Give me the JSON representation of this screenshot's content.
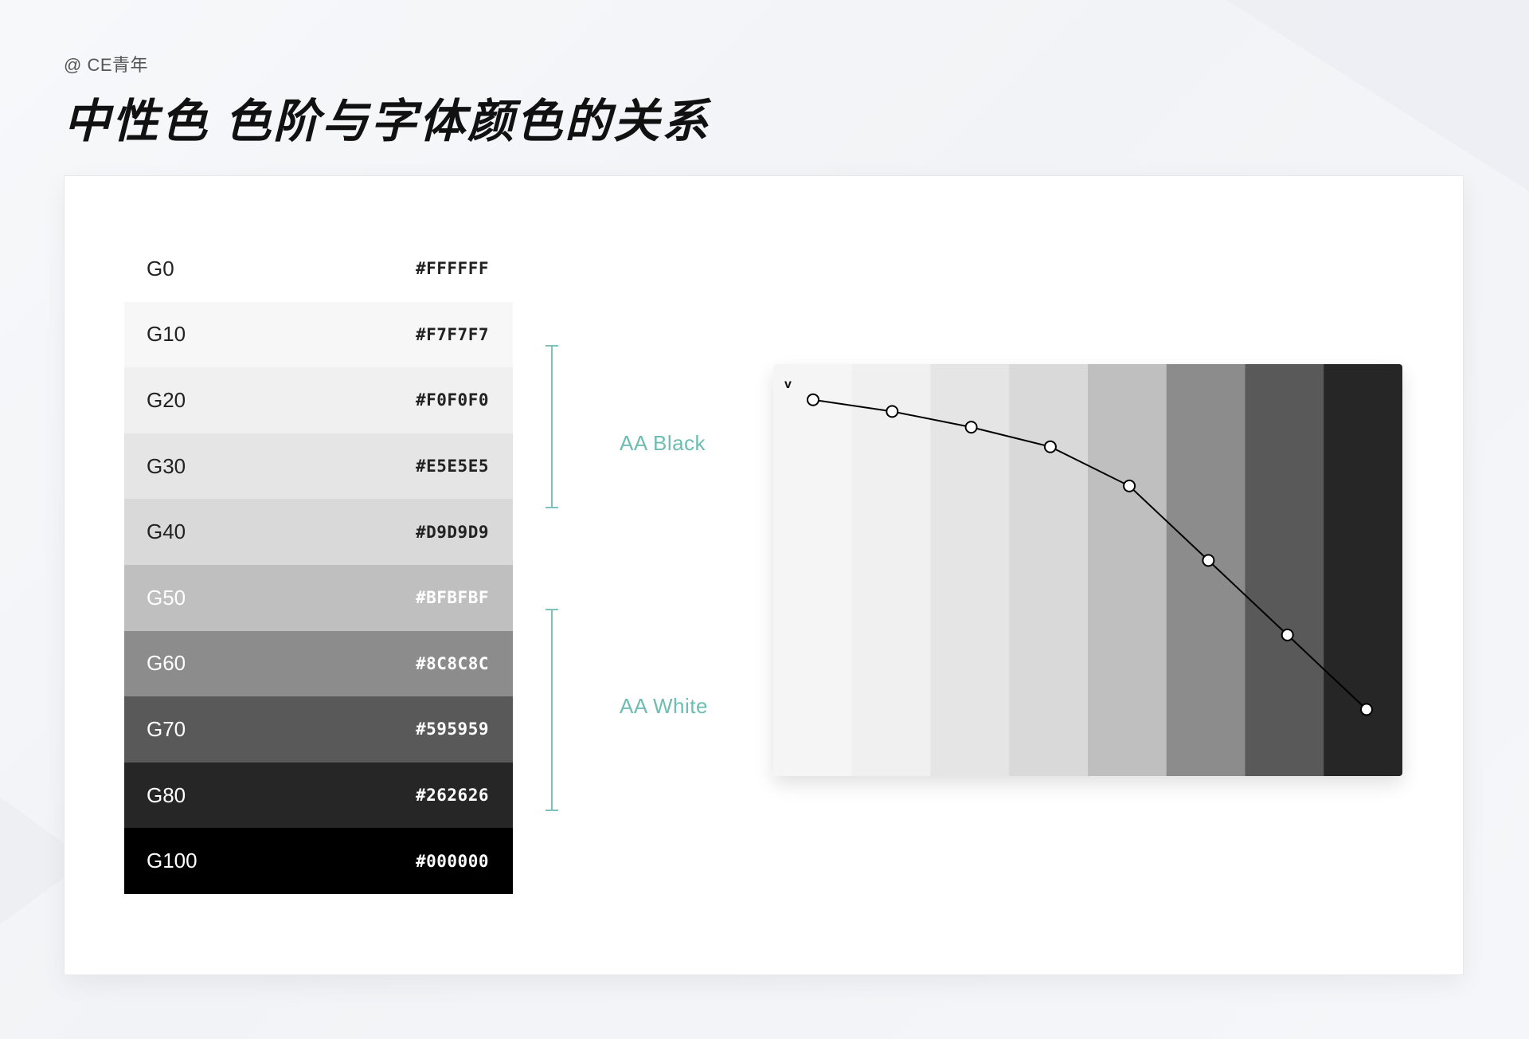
{
  "header": {
    "credit": "@ CE青年",
    "title": "中性色 色阶与字体颜色的关系"
  },
  "swatches": [
    {
      "name": "G0",
      "hex": "#FFFFFF",
      "bg": "#FFFFFF",
      "fg": "#222222"
    },
    {
      "name": "G10",
      "hex": "#F7F7F7",
      "bg": "#F7F7F7",
      "fg": "#222222"
    },
    {
      "name": "G20",
      "hex": "#F0F0F0",
      "bg": "#F0F0F0",
      "fg": "#222222"
    },
    {
      "name": "G30",
      "hex": "#E5E5E5",
      "bg": "#E5E5E5",
      "fg": "#222222"
    },
    {
      "name": "G40",
      "hex": "#D9D9D9",
      "bg": "#D9D9D9",
      "fg": "#222222"
    },
    {
      "name": "G50",
      "hex": "#BFBFBF",
      "bg": "#BFBFBF",
      "fg": "#FFFFFF"
    },
    {
      "name": "G60",
      "hex": "#8C8C8C",
      "bg": "#8C8C8C",
      "fg": "#FFFFFF"
    },
    {
      "name": "G70",
      "hex": "#595959",
      "bg": "#595959",
      "fg": "#FFFFFF"
    },
    {
      "name": "G80",
      "hex": "#262626",
      "bg": "#262626",
      "fg": "#FFFFFF"
    },
    {
      "name": "G100",
      "hex": "#000000",
      "bg": "#000000",
      "fg": "#FFFFFF"
    }
  ],
  "contrast_groups": {
    "black_label": "AA Black",
    "white_label": "AA White",
    "accent": "#6DBDB2"
  },
  "curve": {
    "axis_label": "v",
    "columns": [
      "#F5F5F5",
      "#F0F0F0",
      "#E5E5E5",
      "#D9D9D9",
      "#BFBFBF",
      "#8C8C8C",
      "#595959",
      "#262626"
    ],
    "v_values": [
      96,
      93,
      89,
      84,
      74,
      55,
      36,
      17
    ],
    "v_max": 100
  }
}
